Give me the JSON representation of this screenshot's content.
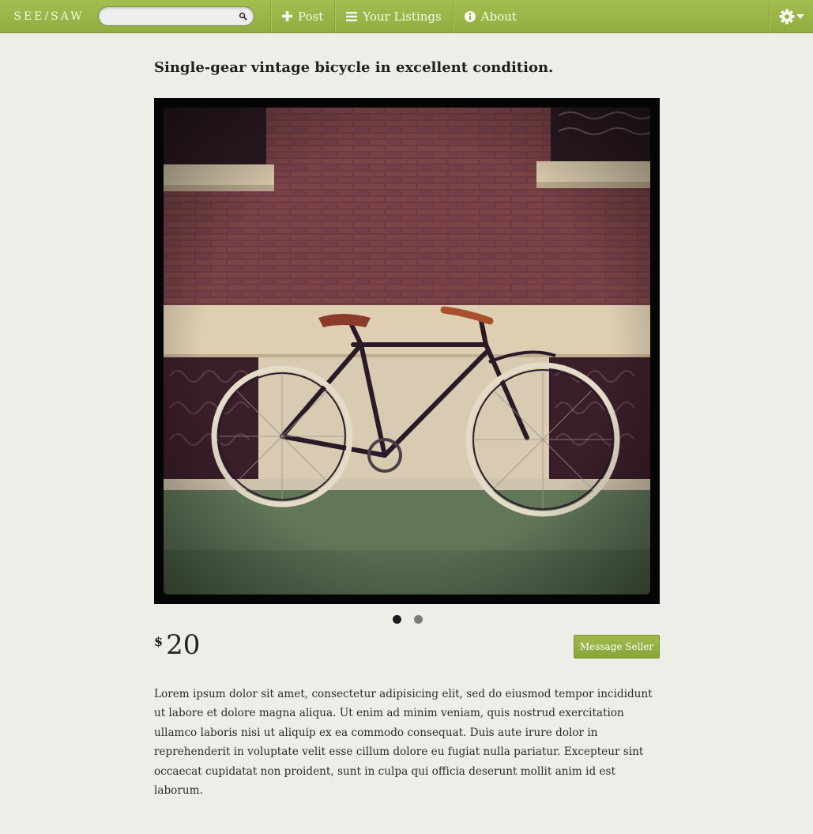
{
  "navbar": {
    "brand": "SEE/SAW",
    "search": {
      "placeholder": "",
      "value": ""
    },
    "items": [
      {
        "label": "Post",
        "icon": "plus-icon"
      },
      {
        "label": "Your Listings",
        "icon": "list-icon"
      },
      {
        "label": "About",
        "icon": "info-icon"
      }
    ],
    "settings_icon": "gear-icon",
    "accent_color": "#9ab648"
  },
  "listing": {
    "title": "Single-gear vintage bicycle in excellent condition.",
    "image_subject": "vintage bicycle in front of brick wall",
    "carousel": {
      "count": 2,
      "active": 1
    },
    "price": {
      "currency": "$",
      "amount": "20"
    },
    "message_button": "Message Seller",
    "description": "Lorem ipsum dolor sit amet, consectetur adipisicing elit, sed do eiusmod tempor incididunt ut labore et dolore magna aliqua. Ut enim ad minim veniam, quis nostrud exercitation ullamco laboris nisi ut aliquip ex ea commodo consequat. Duis aute irure dolor in reprehenderit in voluptate velit esse cillum dolore eu fugiat nulla pariatur. Excepteur sint occaecat cupidatat non proident, sunt in culpa qui officia deserunt mollit anim id est laborum."
  }
}
